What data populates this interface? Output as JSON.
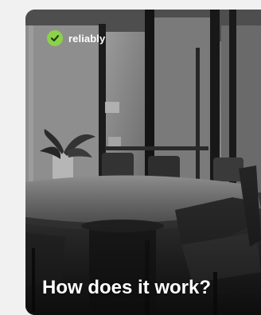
{
  "brand": {
    "name": "reliably",
    "icon": "check-circle-icon",
    "accent_color": "#8dd14a"
  },
  "hero": {
    "headline": "How does it work?",
    "image": "office-meeting-room-photo"
  }
}
